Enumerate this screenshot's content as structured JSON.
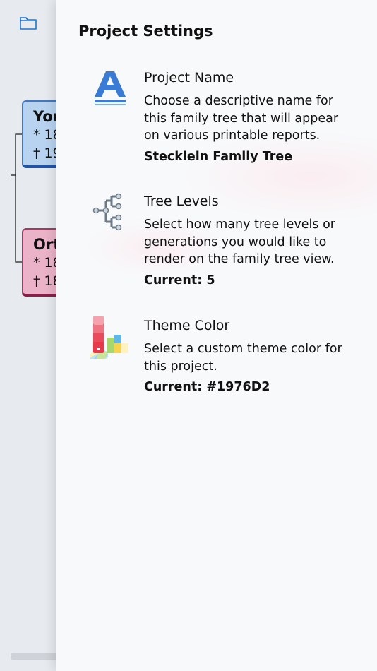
{
  "background": {
    "cards": [
      {
        "name": "You",
        "birth": "* 18",
        "death": "† 19"
      },
      {
        "name": "Ort",
        "birth": "* 18",
        "death": "† 18"
      }
    ]
  },
  "settings": {
    "title": "Project Settings",
    "items": [
      {
        "icon": "letter-a-icon",
        "title": "Project Name",
        "description": "Choose a descriptive name for this family tree that will appear on various printable reports.",
        "value": "Stecklein Family Tree"
      },
      {
        "icon": "tree-levels-icon",
        "title": "Tree Levels",
        "description": "Select how many tree levels or generations you would like to render on the family tree view.",
        "value": "Current: 5"
      },
      {
        "icon": "color-palette-icon",
        "title": "Theme Color",
        "description": "Select a custom theme color for this project.",
        "value": "Current: #1976D2"
      }
    ]
  },
  "colors": {
    "accent": "#1976D2",
    "panel_bg": "#f8f9fb",
    "male_card": "#b7d3f0",
    "female_card": "#ebb3c7"
  }
}
